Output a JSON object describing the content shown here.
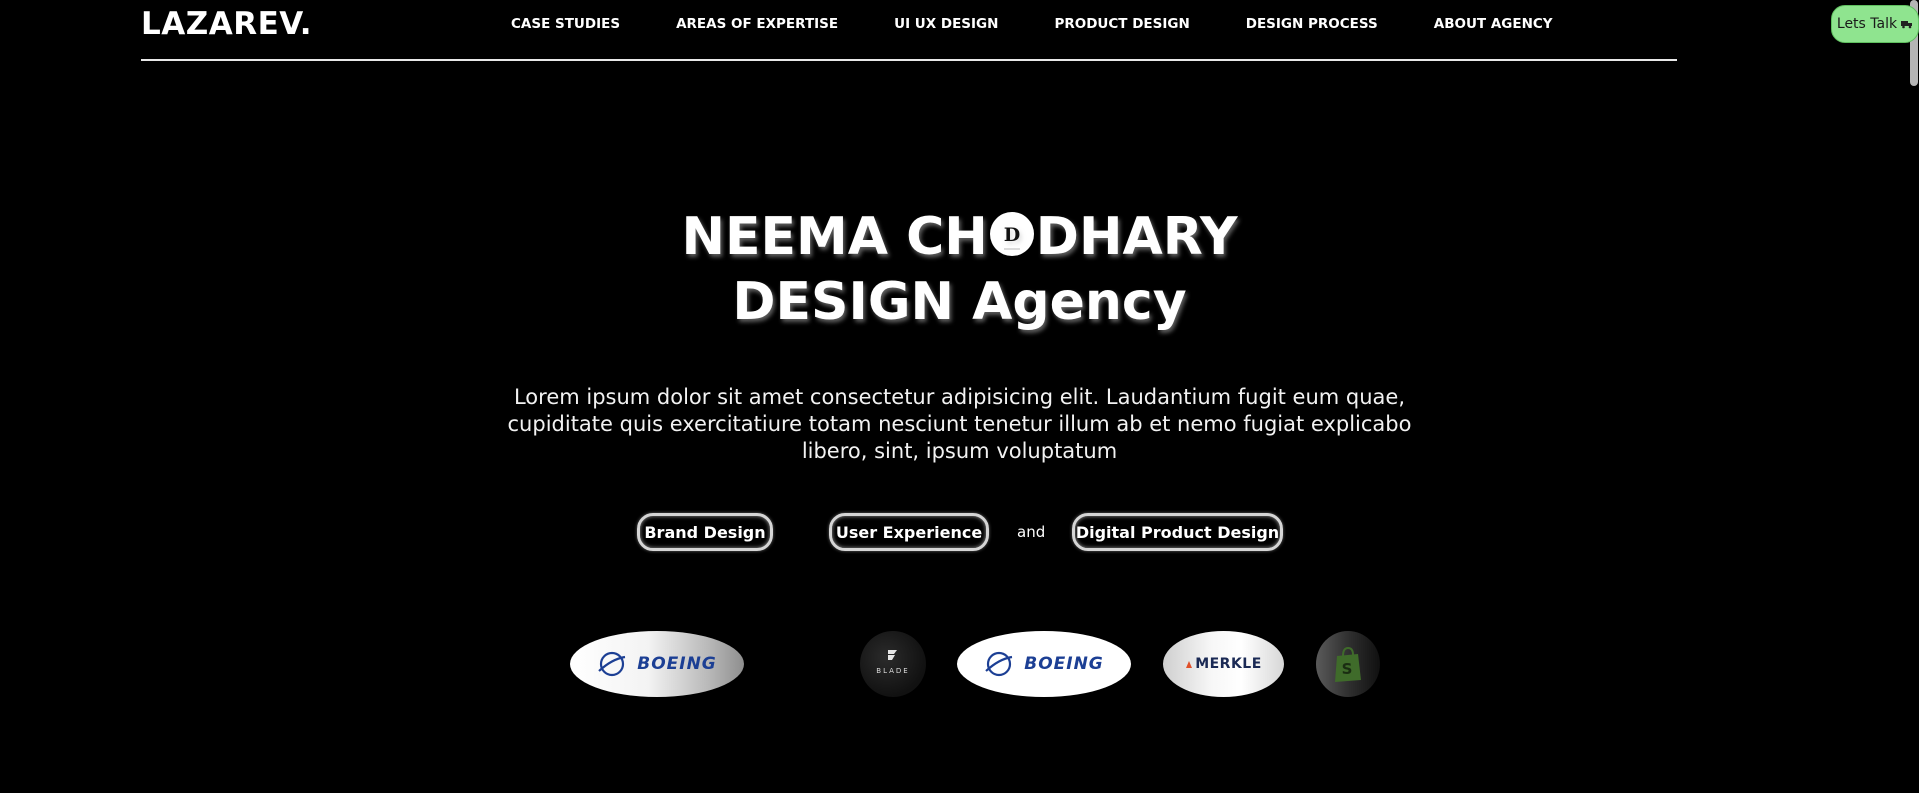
{
  "header": {
    "logo": "LAZAREV.",
    "nav": [
      {
        "label": "CASE STUDIES"
      },
      {
        "label": "AREAS OF EXPERTISE"
      },
      {
        "label": "UI UX DESIGN"
      },
      {
        "label": "PRODUCT DESIGN"
      },
      {
        "label": "DESIGN PROCESS"
      },
      {
        "label": "ABOUT AGENCY"
      }
    ],
    "cta_label": "Lets Talk",
    "cta_icon": "truck-icon",
    "cta_color": "#8fe48f"
  },
  "hero": {
    "title_part1": "NEEMA CH",
    "title_part2": "DHARY",
    "title_line2": "DESIGN Agency",
    "badge_letter": "D",
    "description": "Lorem ipsum dolor sit amet consectetur adipisicing elit. Laudantium fugit eum quae, cupiditate quis exercitatiure totam nesciunt tenetur illum ab et nemo fugiat explicabo libero, sint, ipsum voluptatum"
  },
  "tags": {
    "items": [
      {
        "label": "Brand Design"
      },
      {
        "label": "User Experience"
      },
      {
        "label": "Digital Product Design"
      }
    ],
    "connector": "and"
  },
  "client_logos": {
    "items": [
      {
        "name": "boeing",
        "text": "BOEING"
      },
      {
        "name": "blade",
        "text": "BLADE"
      },
      {
        "name": "boeing",
        "text": "BOEING"
      },
      {
        "name": "merkle",
        "text": "MERKLE"
      },
      {
        "name": "shopify",
        "text": ""
      }
    ]
  }
}
